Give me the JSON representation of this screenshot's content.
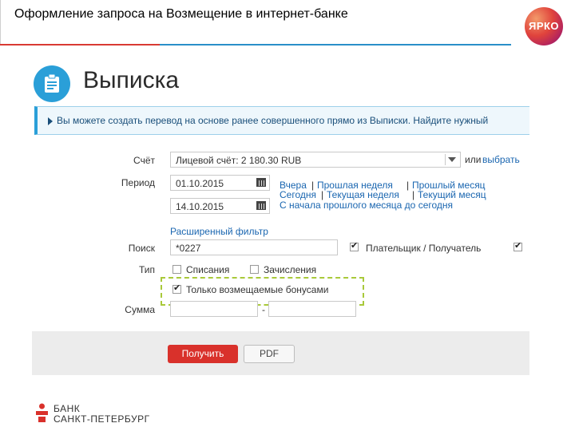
{
  "slide": {
    "title": "Оформление запроса на Возмещение в интернет-банке",
    "badge": "ЯРКО"
  },
  "screen": {
    "heading": "Выписка",
    "info": "Вы можете создать перевод на основе ранее совершенного прямо из Выписки. Найдите нужный",
    "form": {
      "account_label": "Счёт",
      "account_value": "Лицевой счёт:  2 180.30 RUB",
      "account_or": "или",
      "account_choose": "выбрать",
      "period_label": "Период",
      "date_from": "01.10.2015",
      "date_to": "14.10.2015",
      "quick_links": {
        "yesterday": "Вчера",
        "last_week": "Прошлая неделя",
        "last_month": "Прошлый месяц",
        "today": "Сегодня",
        "this_week": "Текущая неделя",
        "this_month": "Текущий месяц",
        "since_last_month": "С начала прошлого месяца до сегодня",
        "sep": "|"
      },
      "advanced_filter": "Расширенный фильтр",
      "search_label": "Поиск",
      "search_value": "*0227",
      "payer_label": "Плательщик / Получатель",
      "payer_checked": true,
      "payer_extra_checked": true,
      "type_label": "Тип",
      "debits_label": "Списания",
      "credits_label": "Зачисления",
      "debits_checked": false,
      "credits_checked": false,
      "bonus_only_label": "Только возмещаемые бонусами",
      "bonus_only_checked": true,
      "amount_label": "Сумма",
      "amount_from": "",
      "amount_to": "",
      "amount_sep": "-"
    },
    "buttons": {
      "get": "Получить",
      "pdf": "PDF"
    }
  },
  "bank": {
    "line1": "БАНК",
    "line2": "САНКТ-ПЕТЕРБУРГ"
  },
  "colors": {
    "accent_red": "#d93a33",
    "accent_blue": "#2a8fc9",
    "link_blue": "#1a66b0",
    "highlight_green": "#a9c93a",
    "button_red": "#d9312b"
  },
  "icons": [
    "clipboard-icon",
    "info-arrow-icon",
    "calendar-icon",
    "dropdown-arrow-icon",
    "checkbox-icon",
    "bank-logo-icon"
  ]
}
